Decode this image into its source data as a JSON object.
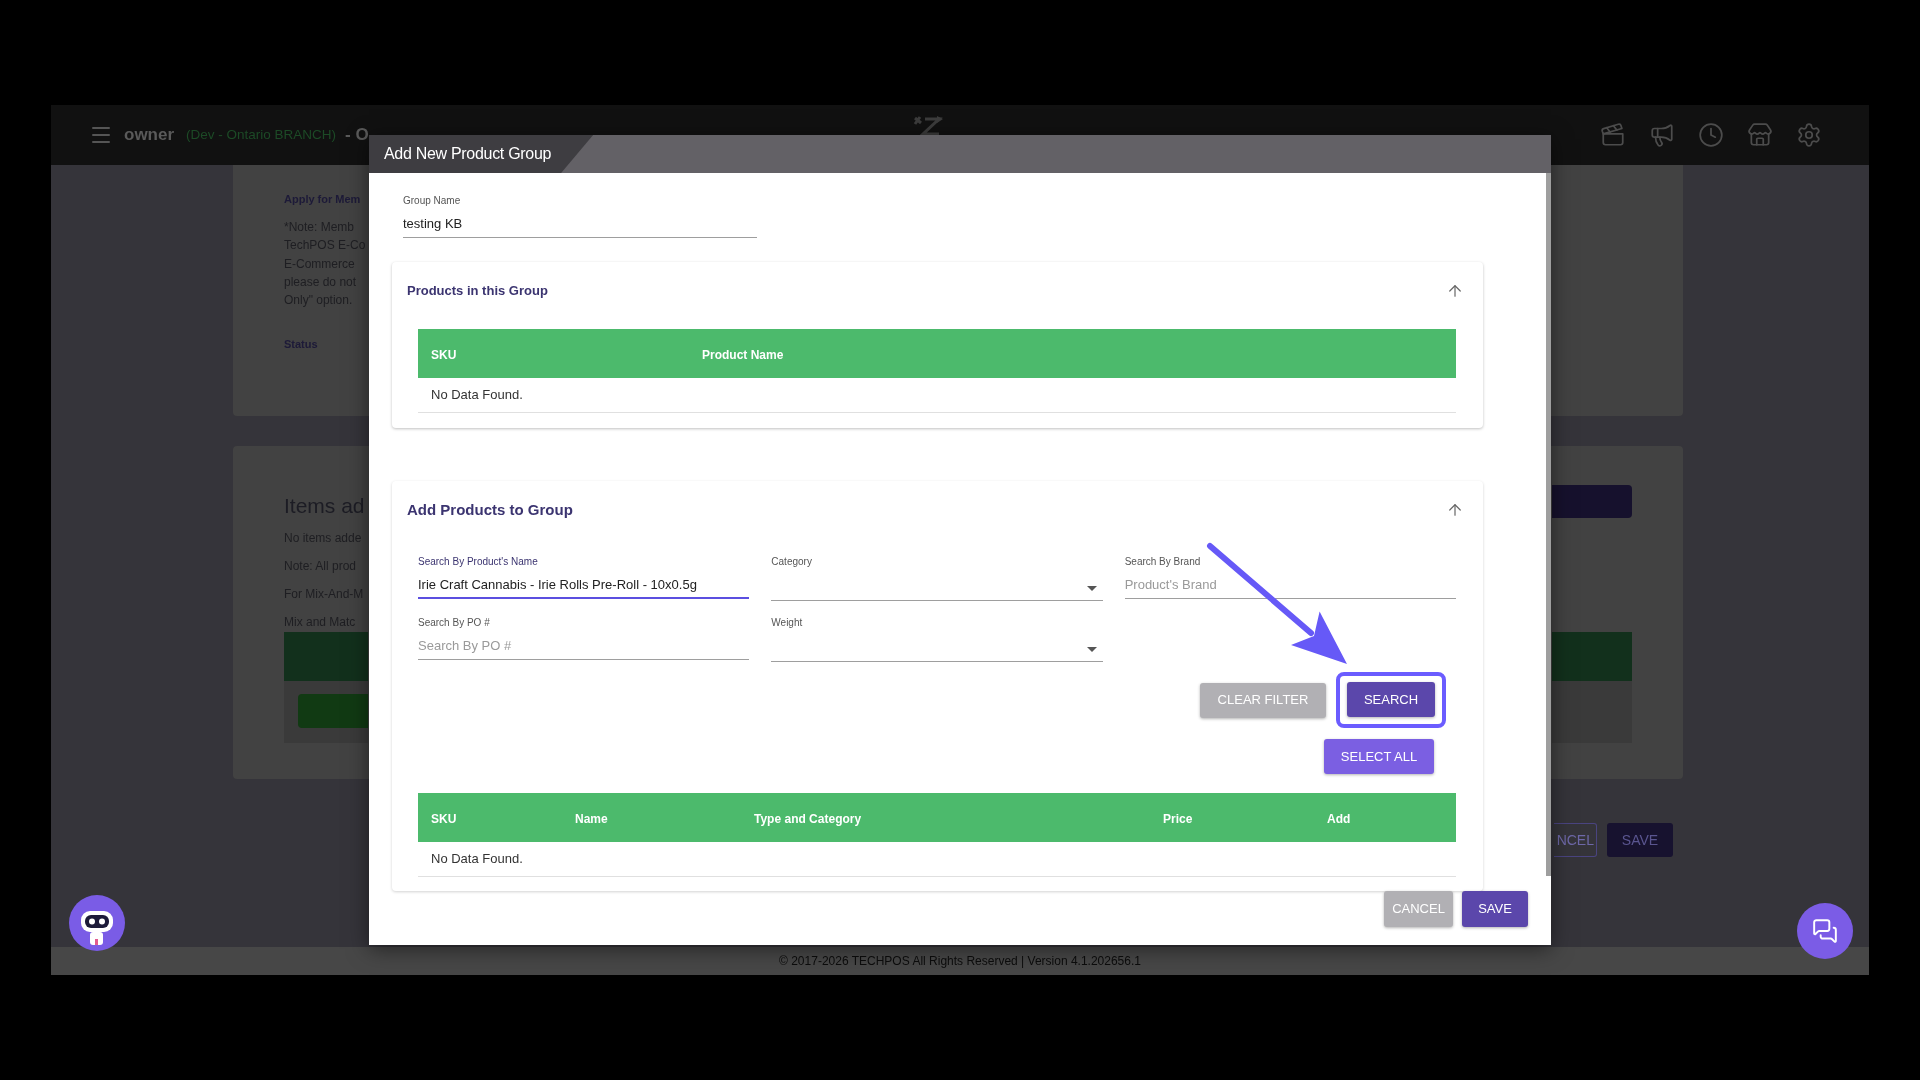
{
  "top_bar": {
    "user": "owner",
    "branch": "(Dev - Ontario BRANCH)",
    "suffix": "- O"
  },
  "background_page": {
    "settings_card": {
      "label": "Apply for Mem",
      "note_lines": [
        "*Note: Memb",
        "TechPOS E-Co",
        "E-Commerce",
        "please do not",
        "Only\" option."
      ],
      "status_label": "Status"
    },
    "items_card": {
      "title": "Items ad",
      "lines": [
        "No items adde",
        "Note: All prod",
        "For Mix-And-M",
        "Mix and Matc"
      ]
    },
    "buttons": [
      {
        "label": "NCEL",
        "kind": "outlined"
      },
      {
        "label": "SAVE",
        "kind": "filled"
      }
    ]
  },
  "dialog": {
    "title": "Add New Product Group",
    "group_name": {
      "label": "Group Name",
      "value": "testing KB"
    },
    "products_section": {
      "title": "Products in this Group",
      "expanded": true,
      "table": {
        "columns": [
          "SKU",
          "Product Name"
        ],
        "empty_message": "No Data Found."
      }
    },
    "add_section": {
      "title": "Add Products to Group",
      "expanded": true,
      "filters": [
        {
          "kind": "text",
          "label": "Search By Product's Name",
          "value": "Irie Craft Cannabis - Irie Rolls Pre-Roll - 10x0.5g",
          "focused": true
        },
        {
          "kind": "select",
          "label": "Category",
          "focused": false
        },
        {
          "kind": "text",
          "label": "Search By Brand",
          "placeholder": "Product's Brand",
          "focused": false
        },
        {
          "kind": "text",
          "label": "Search By PO #",
          "placeholder": "Search By PO #",
          "focused": false
        },
        {
          "kind": "select",
          "label": "Weight",
          "focused": false
        }
      ],
      "buttons": [
        {
          "label": "CLEAR FILTER",
          "kind": "secondary",
          "highlighted": false
        },
        {
          "label": "SEARCH",
          "kind": "primary",
          "highlighted": true
        }
      ],
      "select_all": {
        "label": "SELECT ALL",
        "kind": "accent"
      },
      "table": {
        "columns": [
          "SKU",
          "Name",
          "Type and Category",
          "Price",
          "Add"
        ],
        "empty_message": "No Data Found."
      }
    },
    "actions": [
      {
        "label": "CANCEL",
        "kind": "secondary"
      },
      {
        "label": "SAVE",
        "kind": "primary"
      }
    ]
  },
  "footer": {
    "copyright": "© 2017-2026 TECHPOS All Rights Reserved | Version 4.1.202656.1"
  }
}
